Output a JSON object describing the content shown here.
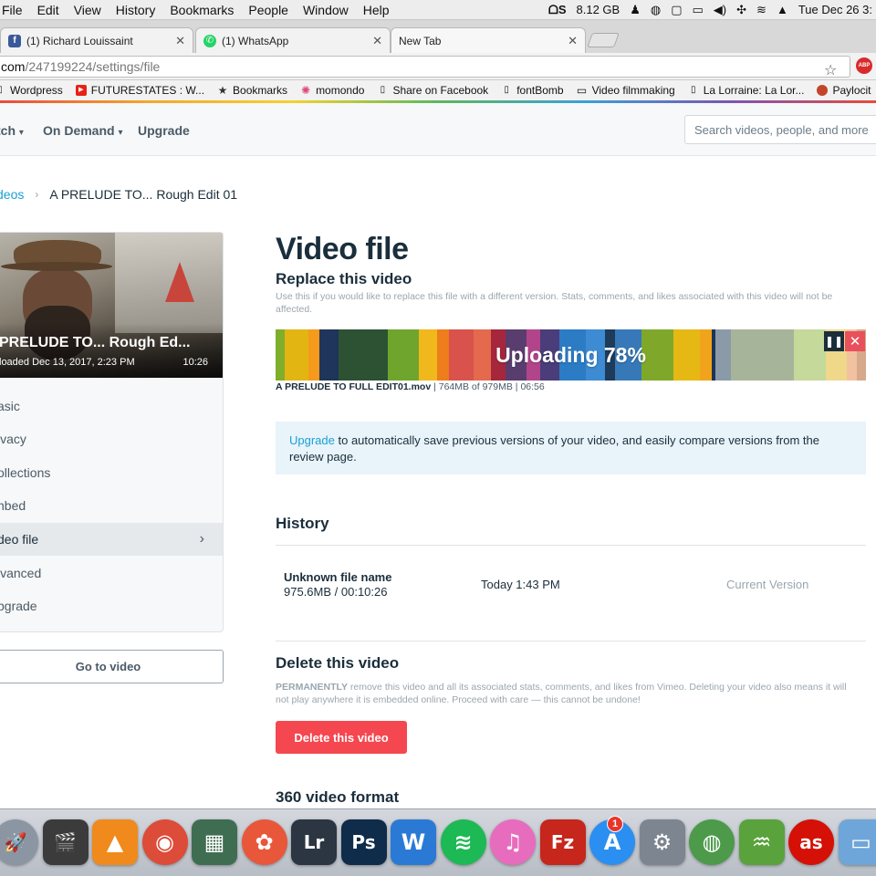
{
  "menubar": {
    "items": [
      "File",
      "Edit",
      "View",
      "History",
      "Bookmarks",
      "People",
      "Window",
      "Help"
    ],
    "memory": "8.12 GB",
    "clock": "Tue Dec 26  3:"
  },
  "tabs": [
    {
      "title": "(1) Richard Louissaint",
      "icon": "facebook-icon",
      "color": "#3b5998"
    },
    {
      "title": "(1) WhatsApp",
      "icon": "whatsapp-icon",
      "color": "#25d366"
    },
    {
      "title": "New Tab",
      "icon": "",
      "color": ""
    }
  ],
  "address_bar": {
    "host": "com",
    "path": "/247199224/settings/file"
  },
  "bookmarks": [
    {
      "label": "Wordpress",
      "icon": "document-icon"
    },
    {
      "label": "FUTURESTATES : W...",
      "icon": "youtube-icon"
    },
    {
      "label": "Bookmarks",
      "icon": "star-icon"
    },
    {
      "label": "momondo",
      "icon": "momondo-icon"
    },
    {
      "label": "Share on Facebook",
      "icon": "document-icon"
    },
    {
      "label": "fontBomb",
      "icon": "document-icon"
    },
    {
      "label": "Video filmmaking",
      "icon": "folder-icon"
    },
    {
      "label": "La Lorraine: La Lor...",
      "icon": "document-icon"
    },
    {
      "label": "Paylocit",
      "icon": "paylocity-icon"
    }
  ],
  "header": {
    "nav": [
      "tch",
      "On Demand",
      "Upgrade"
    ],
    "search_placeholder": "Search videos, people, and more"
  },
  "breadcrumb": {
    "parent": "deos",
    "current": "A PRELUDE TO... Rough Edit 01"
  },
  "sidebar": {
    "video_title": "PRELUDE TO... Rough Ed...",
    "uploaded": "loaded Dec 13, 2017, 2:23 PM",
    "duration": "10:26",
    "items": [
      {
        "label": "asic",
        "active": false
      },
      {
        "label": "ivacy",
        "active": false
      },
      {
        "label": "ollections",
        "active": false
      },
      {
        "label": "nbed",
        "active": false
      },
      {
        "label": "deo file",
        "active": true
      },
      {
        "label": "lvanced",
        "active": false
      },
      {
        "label": "pgrade",
        "active": false
      }
    ],
    "go_to_video": "Go to video"
  },
  "main": {
    "title": "Video file",
    "replace_heading": "Replace this video",
    "replace_desc": "Use this if you would like to replace this file with a different version. Stats, comments, and likes associated with this video will not be affected.",
    "upload": {
      "label": "Uploading 78%",
      "progress": 0.78,
      "stripe_colors": [
        "#7fae2a",
        "#e2b513",
        "#f59a1c",
        "#1f3559",
        "#2d5233",
        "#2d5233",
        "#6fa52c",
        "#f0b81c",
        "#ee7d1c",
        "#d9534c",
        "#e56a4d",
        "#a6273b",
        "#5a3d6f",
        "#b2458a",
        "#4a3d7a",
        "#2b7cc4",
        "#3c8bd3",
        "#1e3b5a",
        "#3779b8",
        "#7fa82a",
        "#e6b814",
        "#f1a41b",
        "#1c3656",
        "#8b9aa8",
        "#a6b59a",
        "#a6b59a",
        "#c4d99a",
        "#f0d88a",
        "#f2c2a0",
        "#d6a98c"
      ],
      "file_name": "A PRELUDE TO FULL EDIT01.mov",
      "file_progress": "764MB of 979MB",
      "file_time": "06:56"
    },
    "upgrade_link": "Upgrade",
    "upgrade_text": " to automatically save previous versions of your video, and easily compare versions from the review page.",
    "history_heading": "History",
    "history": {
      "name": "Unknown file name",
      "meta": "975.6MB / 00:10:26",
      "date": "Today 1:43 PM",
      "version": "Current Version"
    },
    "delete_heading": "Delete this video",
    "delete_desc_strong": "PERMANENTLY",
    "delete_desc": " remove this video and all its associated stats, comments, and likes from Vimeo. Deleting your video also means it will not play anywhere it is embedded online. Proceed with care — this cannot be undone!",
    "delete_button": "Delete this video",
    "format_heading": "360 video format"
  },
  "dock": {
    "apps": [
      {
        "name": "launchpad-icon",
        "glyph": "🚀",
        "color": "#8c96a3"
      },
      {
        "name": "final-cut-icon",
        "glyph": "🎬",
        "color": "#3b3b3b"
      },
      {
        "name": "vlc-icon",
        "glyph": "▲",
        "color": "#f08a1c"
      },
      {
        "name": "chrome-icon",
        "glyph": "◉",
        "color": "#dd4b39"
      },
      {
        "name": "photo-booth-icon",
        "glyph": "▦",
        "color": "#3f6d52"
      },
      {
        "name": "davinci-icon",
        "glyph": "✿",
        "color": "#e8573a"
      },
      {
        "name": "lightroom-icon",
        "glyph": "Lr",
        "color": "#2b3642"
      },
      {
        "name": "photoshop-icon",
        "glyph": "Ps",
        "color": "#0f2c4a"
      },
      {
        "name": "word-icon",
        "glyph": "W",
        "color": "#2a7ad5"
      },
      {
        "name": "spotify-icon",
        "glyph": "≋",
        "color": "#1db954"
      },
      {
        "name": "itunes-icon",
        "glyph": "♫",
        "color": "#e86cbd"
      },
      {
        "name": "filezilla-icon",
        "glyph": "Fz",
        "color": "#c6261c"
      },
      {
        "name": "app-store-icon",
        "glyph": "A",
        "color": "#2a8ff0"
      },
      {
        "name": "system-preferences-icon",
        "glyph": "⚙",
        "color": "#7c8590"
      },
      {
        "name": "globe-app-icon",
        "glyph": "◍",
        "color": "#4c9a4a"
      },
      {
        "name": "genie-icon",
        "glyph": "♒",
        "color": "#5aa23c"
      },
      {
        "name": "lastfm-icon",
        "glyph": "as",
        "color": "#d51007"
      },
      {
        "name": "folder-icon",
        "glyph": "▭",
        "color": "#6fa6d9"
      }
    ],
    "app_store_badge": "1"
  }
}
